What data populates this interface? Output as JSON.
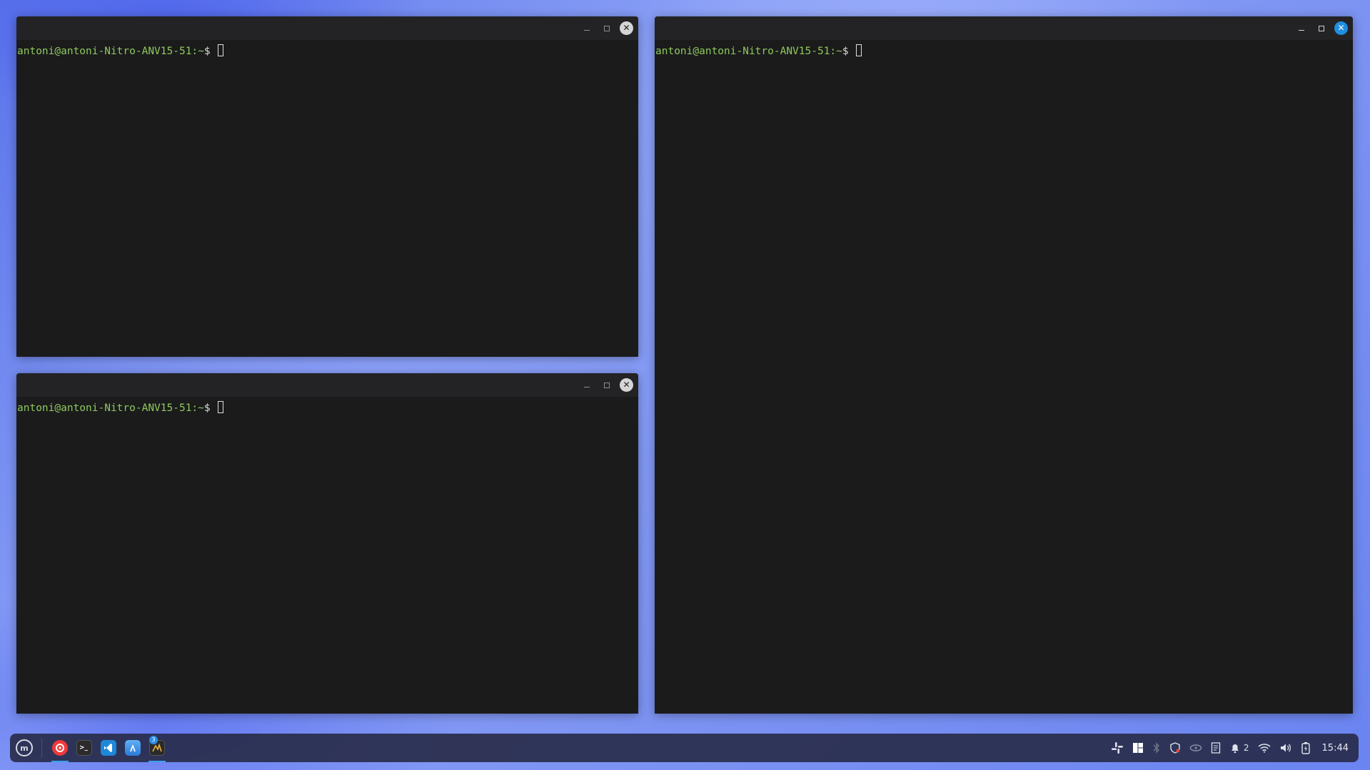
{
  "terminals": [
    {
      "id": "top-left",
      "prompt_user": "antoni@antoni-Nitro-ANV15-51:~",
      "prompt_symbol": "$ "
    },
    {
      "id": "bottom-left",
      "prompt_user": "antoni@antoni-Nitro-ANV15-51:~",
      "prompt_symbol": "$ "
    },
    {
      "id": "right",
      "prompt_user": "antoni@antoni-Nitro-ANV15-51:~",
      "prompt_symbol": "$ "
    }
  ],
  "window_buttons": {
    "minimize": "–",
    "maximize": "□",
    "close": "✕"
  },
  "taskbar": {
    "menu_icon": "linux-mint-menu-icon",
    "apps": [
      {
        "name": "vivaldi-browser-icon",
        "color": "#ef3939",
        "glyph": "V"
      },
      {
        "name": "terminal-icon",
        "color": "#2b2b2b",
        "glyph": ">_"
      },
      {
        "name": "vscode-icon",
        "color": "#1e88d8",
        "glyph": "❮"
      },
      {
        "name": "software-manager-icon",
        "color": "#3c95e0",
        "glyph": "A"
      },
      {
        "name": "system-monitor-icon",
        "color": "#2a2a2a",
        "glyph": "⋀",
        "badge": "3"
      }
    ],
    "tray": {
      "slack_icon": "slack-icon",
      "layout_icon": "tiling-layout-icon",
      "bluetooth_icon": "bluetooth-icon",
      "shield_icon": "update-shield-icon",
      "gpu_icon": "nvidia-gpu-icon",
      "notes_icon": "notes-icon",
      "notifications_icon": "notifications-icon",
      "notifications_count": "2",
      "wifi_icon": "wifi-icon",
      "volume_icon": "volume-icon",
      "battery_icon": "battery-icon",
      "clock": "15:44"
    }
  }
}
